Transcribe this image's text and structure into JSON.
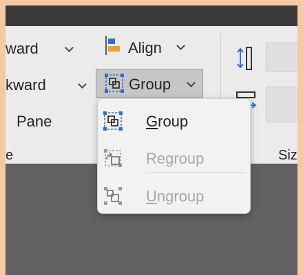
{
  "ribbon": {
    "arrange_items": [
      {
        "label": "ward"
      },
      {
        "label": "kward"
      },
      {
        "label": "Pane"
      }
    ],
    "align_label": "Align",
    "group_label": "Group",
    "section_label_left": "e",
    "section_label_size": "Size"
  },
  "group_menu": {
    "items": [
      {
        "label": "Group",
        "mnemonic_index": 0,
        "enabled": true
      },
      {
        "label": "Regroup",
        "mnemonic_index": 2,
        "enabled": false
      },
      {
        "label": "Ungroup",
        "mnemonic_index": 0,
        "enabled": false
      }
    ]
  },
  "colors": {
    "accent_blue": "#2f6fd1",
    "accent_orange": "#e8a23c",
    "disabled_text": "#a8a8a8",
    "frame_border": "#f5c9a3"
  }
}
